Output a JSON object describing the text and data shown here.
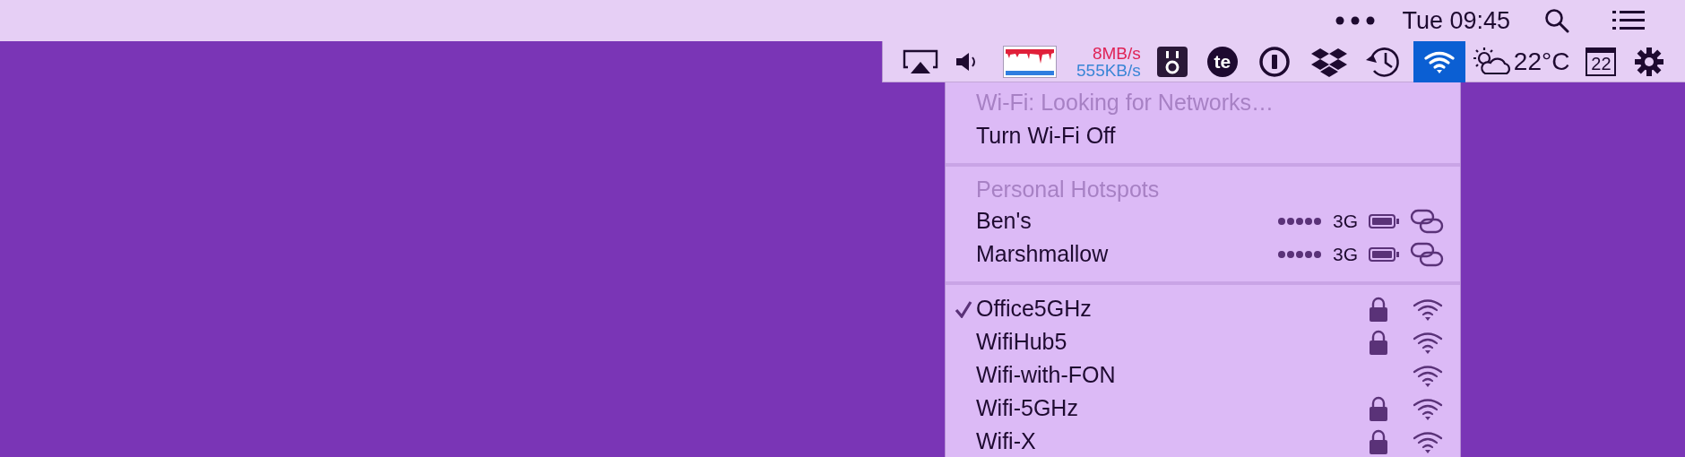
{
  "menu_bar": {
    "clock": "Tue 09:45"
  },
  "status_items": [
    {
      "kind": "airplay",
      "selected": false
    },
    {
      "kind": "volume",
      "selected": false
    },
    {
      "kind": "netgraph",
      "selected": false
    },
    {
      "kind": "speeds",
      "upload": "8MB/s",
      "download": "555KB/s",
      "selected": false
    },
    {
      "kind": "plug",
      "selected": false
    },
    {
      "kind": "badge",
      "label": "te",
      "selected": false
    },
    {
      "kind": "keyhole",
      "selected": false
    },
    {
      "kind": "dropbox",
      "selected": false
    },
    {
      "kind": "timemachine",
      "selected": false
    },
    {
      "kind": "wifi",
      "selected": true
    },
    {
      "kind": "weather",
      "label": "22°C",
      "selected": false
    },
    {
      "kind": "calendar",
      "label": "22",
      "selected": false
    },
    {
      "kind": "gear",
      "selected": false
    }
  ],
  "wifi_menu": {
    "sections": [
      {
        "items": [
          {
            "kind": "action",
            "label": "Wi-Fi: Looking for Networks…",
            "disabled": true
          },
          {
            "kind": "action",
            "label": "Turn Wi-Fi Off",
            "disabled": false
          }
        ]
      },
      {
        "title": "Personal Hotspots",
        "items": [
          {
            "kind": "hotspot",
            "label": "Ben's",
            "network": "3G"
          },
          {
            "kind": "hotspot",
            "label": "Marshmallow",
            "network": "3G"
          }
        ]
      },
      {
        "items": [
          {
            "kind": "network",
            "label": "Office5GHz",
            "checked": true,
            "locked": true
          },
          {
            "kind": "network",
            "label": "WifiHub5",
            "checked": false,
            "locked": true
          },
          {
            "kind": "network",
            "label": "Wifi-with-FON",
            "checked": false,
            "locked": false
          },
          {
            "kind": "network",
            "label": "Wifi-5GHz",
            "checked": false,
            "locked": true
          },
          {
            "kind": "network",
            "label": "Wifi-X",
            "checked": false,
            "locked": true
          }
        ]
      }
    ]
  }
}
